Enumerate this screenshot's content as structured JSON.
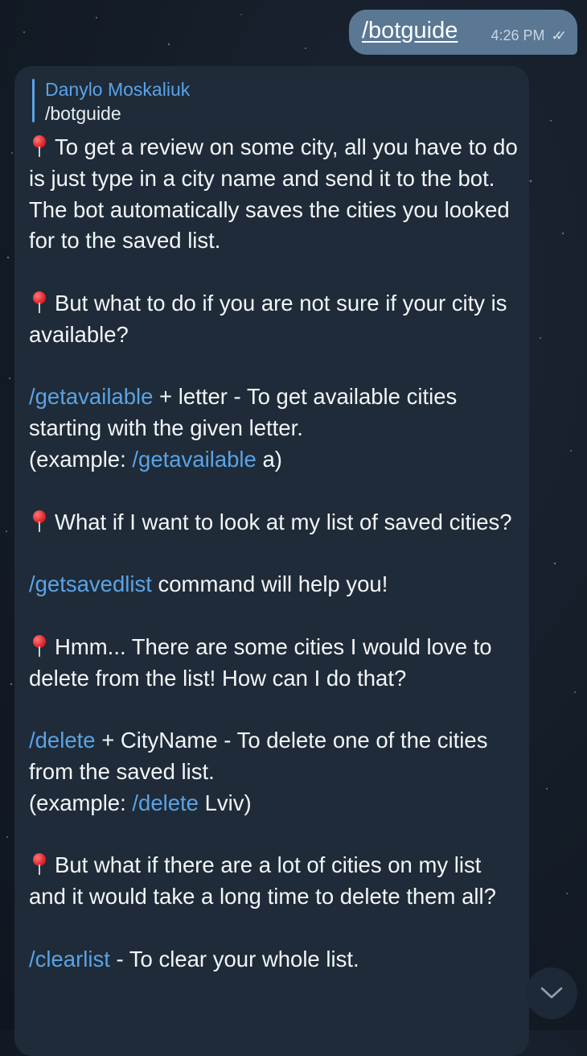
{
  "outgoing": {
    "text": "/botguide",
    "time": "4:26 PM"
  },
  "incoming": {
    "reply_author": "Danylo Moskaliuk",
    "reply_text": "/botguide",
    "p1": "To get a review on some city, all you have to do is just type in a city name and send it to the bot. The bot automatically saves the cities you looked for to the saved list.",
    "p2": "But what to do if you are not sure if your city is available?",
    "p3_cmd": "/getavailable",
    "p3_text": " + letter - To get available cities starting with the given letter.",
    "p3_ex_pre": "(example: ",
    "p3_ex_cmd": "/getavailable",
    "p3_ex_post": " a)",
    "p4": "What if I want to look at my list of saved cities?",
    "p5_cmd": "/getsavedlist",
    "p5_text": " command will help you!",
    "p6": "Hmm... There are some cities I would love to delete from the list! How can I do that?",
    "p7_cmd": "/delete",
    "p7_text": " + CityName - To delete one of the cities from the saved list.",
    "p7_ex_pre": "(example: ",
    "p7_ex_cmd": "/delete",
    "p7_ex_post": " Lviv)",
    "p8": "But what if there are a lot of cities on my list and it would take a long time to delete them all?",
    "p9_cmd": "/clearlist",
    "p9_text": " - To clear your whole list."
  },
  "icons": {
    "pin": "round-pushpin-icon",
    "scroll": "chevron-down-icon",
    "read": "double-check-icon"
  },
  "colors": {
    "link": "#5aa3e6",
    "incoming_bubble": "#1f2b38",
    "outgoing_bubble": "#5a7894"
  }
}
